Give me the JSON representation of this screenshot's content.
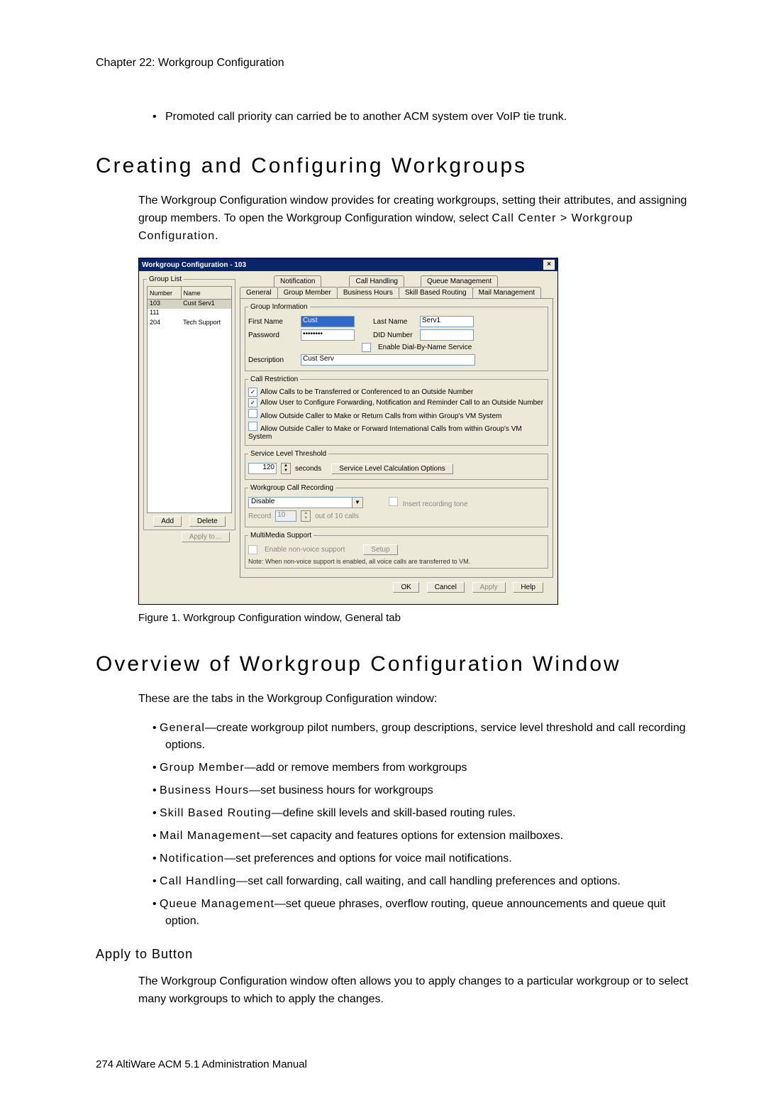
{
  "chapter_head": "Chapter 22:  Workgroup Configuration",
  "top_bullet": "Promoted call priority can carried be to another ACM system over VoIP tie trunk.",
  "h1_a": "Creating and Configuring Workgroups",
  "para_a": "The Workgroup Configuration window provides for creating workgroups, setting their attributes, and assigning group members. To open the Workgroup Configuration window, select ",
  "para_a_path": "Call Center > Workgroup Configuration",
  "para_a_end": ".",
  "dialog": {
    "title": "Workgroup Configuration - 103",
    "group_list_legend": "Group List",
    "col_number": "Number",
    "col_name": "Name",
    "rows": [
      {
        "num": "103",
        "name": "Cust Serv1"
      },
      {
        "num": "111",
        "name": ""
      },
      {
        "num": "204",
        "name": "Tech Support"
      }
    ],
    "btn_add": "Add",
    "btn_delete": "Delete",
    "btn_applyto": "Apply to…",
    "tabs_top": [
      "Notification",
      "Call Handling",
      "Queue Management"
    ],
    "tabs_bot": [
      "General",
      "Group Member",
      "Business Hours",
      "Skill Based Routing",
      "Mail Management"
    ],
    "grp_info_legend": "Group Information",
    "lbl_first": "First Name",
    "val_first": "Cust",
    "lbl_last": "Last Name",
    "val_last": "Serv1",
    "lbl_pwd": "Password",
    "val_pwd": "••••••••",
    "lbl_did": "DID Number",
    "cb_dialbyname": "Enable Dial-By-Name Service",
    "lbl_desc": "Description",
    "val_desc": "Cust Serv",
    "restrict_legend": "Call Restriction",
    "r1": "Allow Calls to be Transferred or Conferenced to an Outside Number",
    "r2": "Allow User to Configure Forwarding, Notification and Reminder Call to an Outside Number",
    "r3": "Allow Outside Caller to Make or Return Calls from within Group's VM System",
    "r4": "Allow Outside Caller to Make or Forward International Calls from within Group's VM System",
    "slt_legend": "Service Level Threshold",
    "slt_val": "120",
    "slt_seconds": "seconds",
    "slt_btn": "Service Level Calculation Options",
    "rec_legend": "Workgroup Call Recording",
    "rec_val": "Disable",
    "rec_cb": "Insert recording tone",
    "rec_record": "Record",
    "rec_record_suffix": "out of 10 calls",
    "mm_legend": "MultiMedia Support",
    "mm_cb": "Enable non-voice support",
    "mm_btn": "Setup",
    "mm_note": "Note: When non-voice support is enabled, all voice calls are transferred to VM.",
    "btn_ok": "OK",
    "btn_cancel": "Cancel",
    "btn_apply": "Apply",
    "btn_help": "Help"
  },
  "fig_caption": "Figure 1.   Workgroup Configuration window, General tab",
  "h1_b": "Overview of Workgroup Configuration Window",
  "ov_intro": "These are the tabs in the Workgroup Configuration window:",
  "ov": [
    {
      "t": "General",
      "d": "—create workgroup pilot numbers, group descriptions, service level threshold and call recording options."
    },
    {
      "t": "Group Member",
      "d": "—add or remove members from workgroups"
    },
    {
      "t": "Business Hours",
      "d": "—set business hours for workgroups"
    },
    {
      "t": "Skill Based Routing",
      "d": "—define skill levels and skill-based routing rules."
    },
    {
      "t": "Mail Management",
      "d": "—set capacity and features options for extension mailboxes."
    },
    {
      "t": "Notification",
      "d": "—set preferences and options for voice mail notifications."
    },
    {
      "t": "Call Handling",
      "d": "—set call forwarding, call waiting, and call handling preferences and options."
    },
    {
      "t": "Queue Management",
      "d": "—set queue phrases, overflow routing, queue announcements and queue quit option."
    }
  ],
  "h3_apply": "Apply to Button",
  "apply_para": "The Workgroup Configuration window often allows you to apply changes to a particular workgroup or to select many workgroups to which to apply the changes.",
  "footer": "274   AltiWare ACM 5.1 Administration Manual"
}
